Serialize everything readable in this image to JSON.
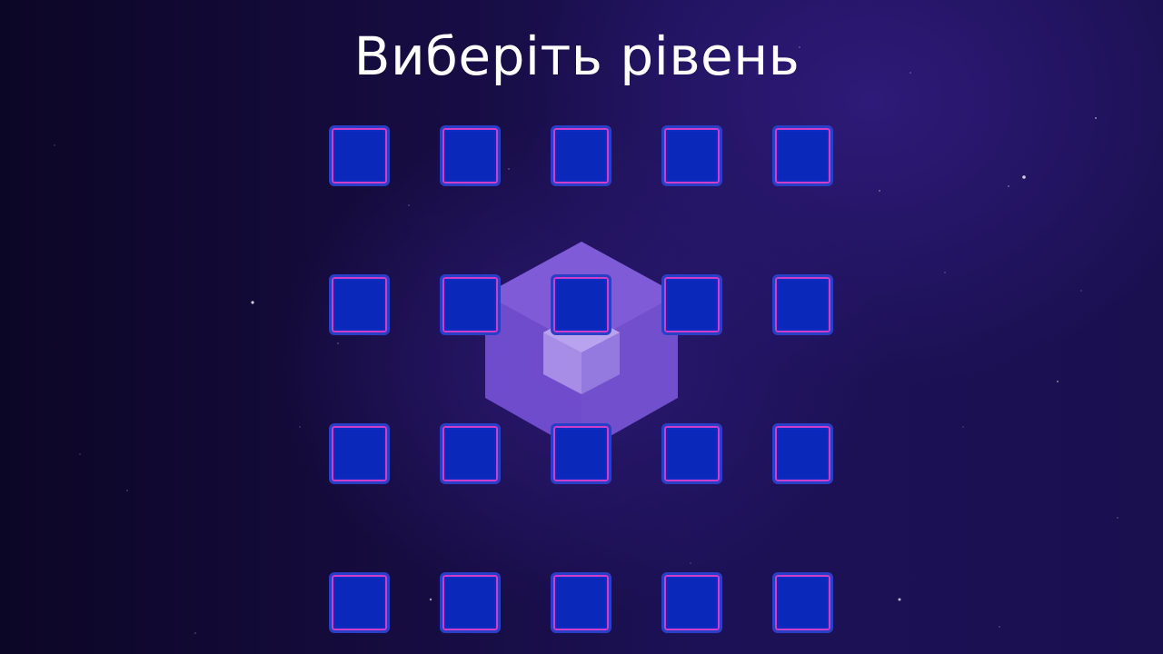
{
  "screen": {
    "title": "Виберіть рівень"
  },
  "emblem": {
    "icon": "cube-hexagon-icon",
    "outer_color": "#7a55d8",
    "inner_color": "#a78de6"
  },
  "levels": {
    "rows": 4,
    "columns": 5,
    "button_fill": "#0c2cc4",
    "button_border": "#cf3ec8",
    "items": [
      {
        "row": 1,
        "col": 1
      },
      {
        "row": 1,
        "col": 2
      },
      {
        "row": 1,
        "col": 3
      },
      {
        "row": 1,
        "col": 4
      },
      {
        "row": 1,
        "col": 5
      },
      {
        "row": 2,
        "col": 1
      },
      {
        "row": 2,
        "col": 2
      },
      {
        "row": 2,
        "col": 3
      },
      {
        "row": 2,
        "col": 4
      },
      {
        "row": 2,
        "col": 5
      },
      {
        "row": 3,
        "col": 1
      },
      {
        "row": 3,
        "col": 2
      },
      {
        "row": 3,
        "col": 3
      },
      {
        "row": 3,
        "col": 4
      },
      {
        "row": 3,
        "col": 5
      },
      {
        "row": 4,
        "col": 1
      },
      {
        "row": 4,
        "col": 2
      },
      {
        "row": 4,
        "col": 3
      },
      {
        "row": 4,
        "col": 4
      },
      {
        "row": 4,
        "col": 5
      }
    ]
  },
  "colors": {
    "background_dark": "#0c0626",
    "background_purple": "#1c1156",
    "title_text": "#ffffff"
  }
}
